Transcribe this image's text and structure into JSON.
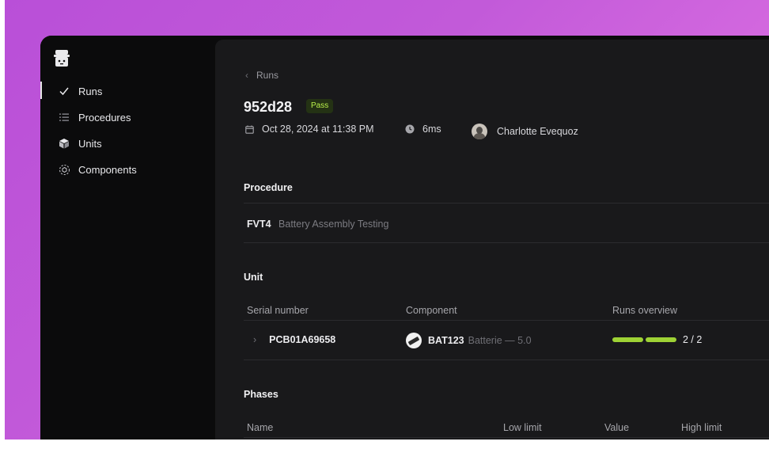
{
  "sidebar": {
    "items": [
      {
        "label": "Runs",
        "icon": "check-icon"
      },
      {
        "label": "Procedures",
        "icon": "list-icon"
      },
      {
        "label": "Units",
        "icon": "cube-icon"
      },
      {
        "label": "Components",
        "icon": "components-icon"
      }
    ]
  },
  "header": {
    "breadcrumb": "Runs",
    "run_id": "952d28",
    "status": "Pass",
    "date": "Oct 28, 2024 at 11:38 PM",
    "duration": "6ms",
    "operator": "Charlotte Evequoz"
  },
  "procedure": {
    "section_title": "Procedure",
    "code": "FVT4",
    "name": "Battery Assembly Testing"
  },
  "unit": {
    "section_title": "Unit",
    "columns": [
      "Serial number",
      "Component",
      "Runs overview"
    ],
    "row": {
      "serial": "PCB01A69658",
      "component_code": "BAT123",
      "component_desc": "Batterie — 5.0",
      "runs_passed": 2,
      "runs_total": 2,
      "runs_text": "2 / 2"
    }
  },
  "phases": {
    "section_title": "Phases",
    "columns": [
      "Name",
      "Low limit",
      "Value",
      "High limit"
    ]
  },
  "colors": {
    "accent_green": "#9ed235",
    "pass_badge_bg": "#243214",
    "pass_badge_text": "#b8ef4a"
  }
}
